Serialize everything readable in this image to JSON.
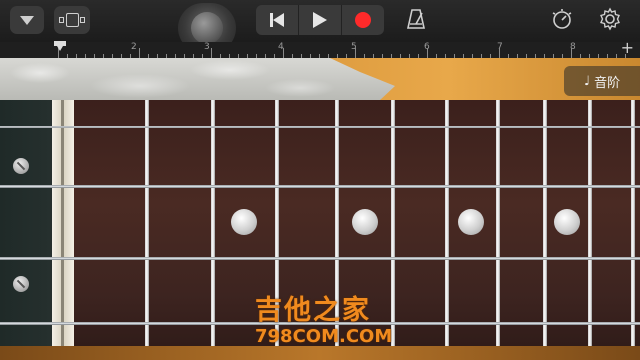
{
  "toolbar": {
    "menu_icon": "triangle-down-icon",
    "view_icon": "track-view-icon",
    "mod_wheel": "modulation-wheel",
    "rewind_icon": "rewind-icon",
    "play_icon": "play-icon",
    "record_icon": "record-icon",
    "metronome_icon": "metronome-icon",
    "tempo_icon": "tempo-dial-icon",
    "settings_icon": "settings-gear-icon",
    "record_color": "#ff2a2a"
  },
  "ruler": {
    "bar_numbers": [
      "2",
      "3",
      "4",
      "5",
      "6",
      "7",
      "8"
    ],
    "add_label": "+"
  },
  "notes_button": {
    "icon": "♩",
    "label": "音阶"
  },
  "fretboard": {
    "accent_colors": {
      "pickguard": "#d9963a",
      "board": "#4a2a23",
      "nut": "#f4f0e6"
    }
  },
  "watermark": {
    "title": "吉他之家",
    "url": "798COM.COM"
  }
}
